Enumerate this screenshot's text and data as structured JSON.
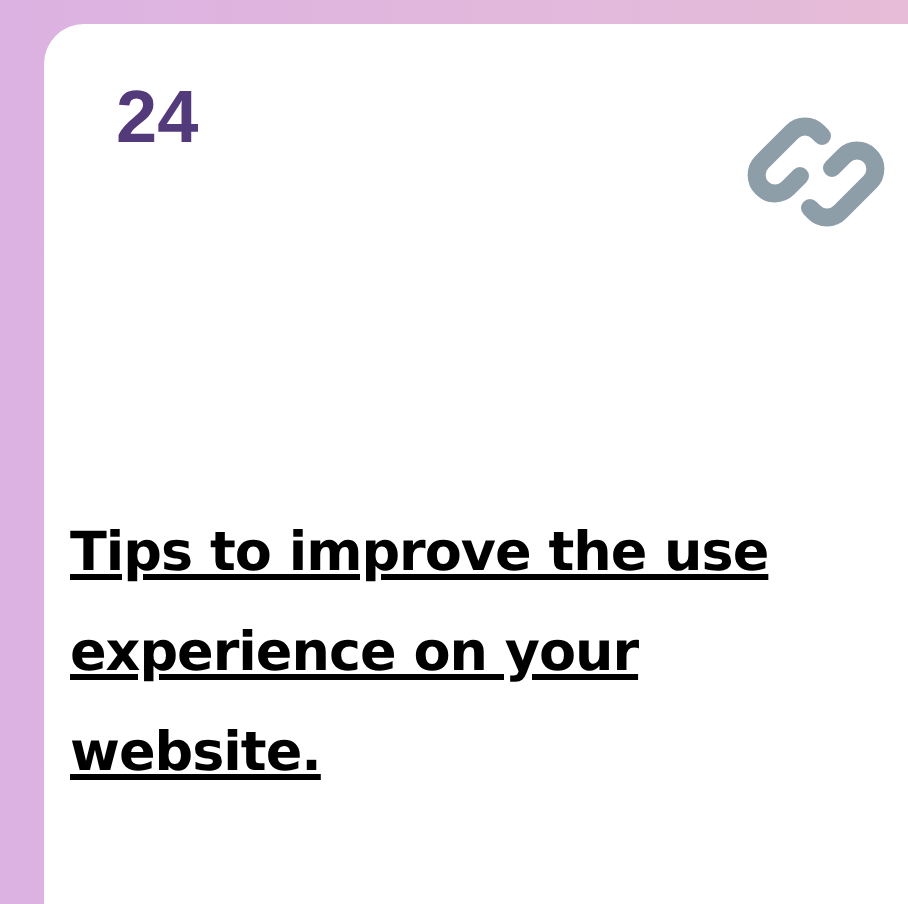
{
  "card": {
    "number": "24",
    "title_lines": [
      "Tips to improve the use",
      "experience on your",
      "website."
    ]
  }
}
